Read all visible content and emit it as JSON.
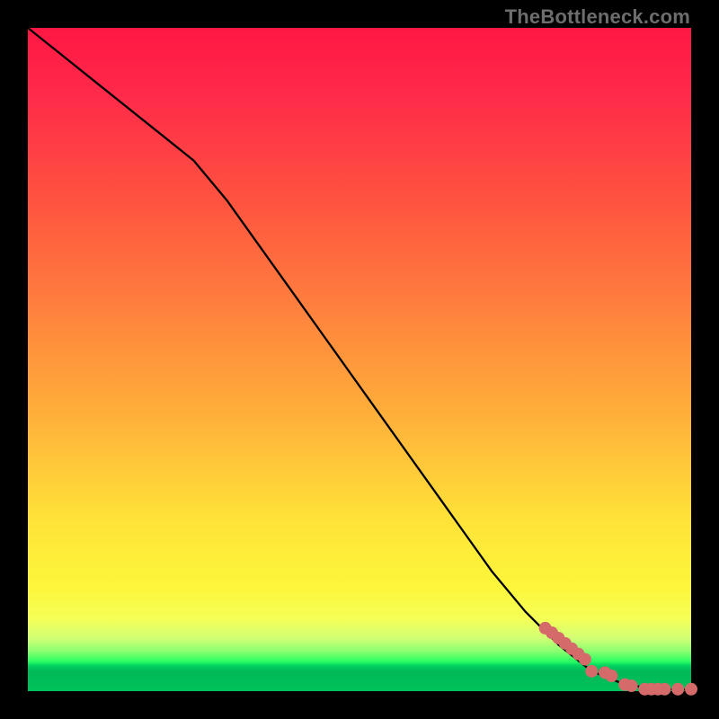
{
  "attribution": "TheBottleneck.com",
  "chart_data": {
    "type": "line",
    "title": "",
    "xlabel": "",
    "ylabel": "",
    "xlim": [
      0,
      100
    ],
    "ylim": [
      0,
      100
    ],
    "series": [
      {
        "name": "curve",
        "x": [
          0,
          5,
          10,
          15,
          20,
          25,
          30,
          35,
          40,
          45,
          50,
          55,
          60,
          65,
          70,
          75,
          80,
          85,
          90,
          95,
          100
        ],
        "y": [
          100,
          96,
          92,
          88,
          84,
          80,
          74,
          67,
          60,
          53,
          46,
          39,
          32,
          25,
          18,
          12,
          7,
          3,
          1,
          0.3,
          0.2
        ],
        "color": "#000000",
        "stroke_width": 2.3
      },
      {
        "name": "highlight-points",
        "x": [
          78,
          79,
          80,
          81,
          82,
          83,
          84,
          85,
          87,
          88,
          90,
          91,
          93,
          94,
          95,
          96,
          98,
          100
        ],
        "y": [
          9.5,
          8.8,
          8.0,
          7.2,
          6.4,
          5.6,
          4.8,
          3.0,
          2.8,
          2.3,
          1.0,
          0.8,
          0.3,
          0.3,
          0.3,
          0.3,
          0.3,
          0.3
        ],
        "color": "#d46a6a",
        "marker_radius": 7
      }
    ]
  },
  "colors": {
    "background": "#000000",
    "attribution_text": "#6d6d6d",
    "curve": "#000000",
    "points": "#d46a6a"
  }
}
